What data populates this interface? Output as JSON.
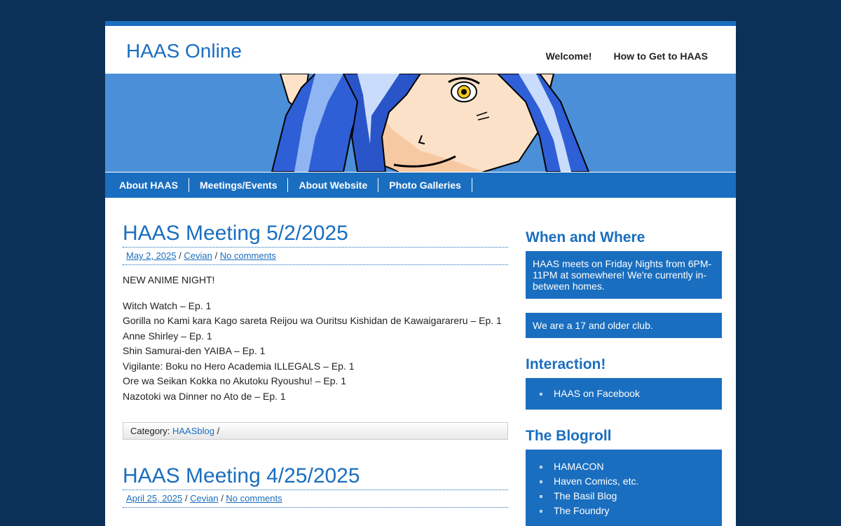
{
  "site": {
    "title": "HAAS Online"
  },
  "top_nav": [
    "Welcome!",
    "How to Get to HAAS"
  ],
  "main_nav": [
    "About HAAS",
    "Meetings/Events",
    "About Website",
    "Photo Galleries"
  ],
  "posts": [
    {
      "title": "HAAS Meeting 5/2/2025",
      "date": "May 2, 2025",
      "author": "Cevian",
      "comments": "No comments",
      "intro": "NEW ANIME NIGHT!",
      "lines": [
        "Witch Watch – Ep. 1",
        "Gorilla no Kami kara Kago sareta Reijou wa Ouritsu Kishidan de Kawaigarareru – Ep. 1",
        "Anne Shirley – Ep. 1",
        "Shin Samurai-den YAIBA – Ep. 1",
        "Vigilante: Boku no Hero Academia ILLEGALS – Ep. 1",
        "Ore wa Seikan Kokka no Akutoku Ryoushu! – Ep. 1",
        "Nazotoki wa Dinner no Ato de – Ep. 1"
      ],
      "category_label": "Category:",
      "category": "HAASblog",
      "category_suffix": "/"
    },
    {
      "title": "HAAS Meeting 4/25/2025",
      "date": "April 25, 2025",
      "author": "Cevian",
      "comments": "No comments"
    }
  ],
  "sidebar": {
    "when_where": {
      "title": "When and Where",
      "text1": "HAAS meets on Friday Nights from 6PM-11PM at somewhere! We're currently in-between homes.",
      "text2": "We are a 17 and older club."
    },
    "interaction": {
      "title": "Interaction!",
      "links": [
        "HAAS on Facebook"
      ]
    },
    "blogroll": {
      "title": "The Blogroll",
      "links": [
        "HAMACON",
        "Haven Comics, etc.",
        "The Basil Blog",
        "The Foundry"
      ]
    }
  },
  "colors": {
    "page_bg": "#0c3159",
    "accent": "#1a6ebf",
    "banner": "#4a8fd8",
    "content_bg": "#ffffff"
  }
}
